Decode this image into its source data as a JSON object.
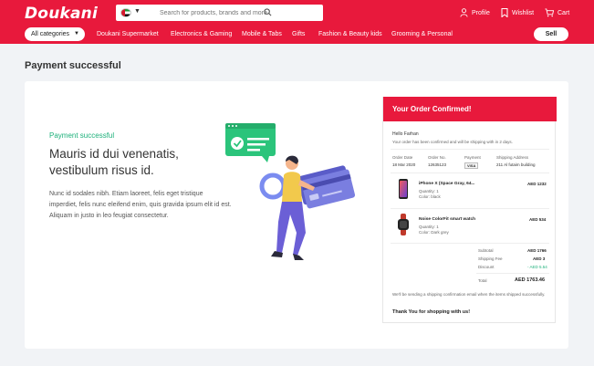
{
  "header": {
    "logo": "Doukani",
    "search_placeholder": "Search for products, brands and more",
    "profile": "Profile",
    "wishlist": "Wishlist",
    "cart": "Cart"
  },
  "catbar": {
    "all_categories": "All categories",
    "links": [
      "Doukani Supermarket",
      "Electronics & Gaming",
      "Mobile & Tabs",
      "Gifts",
      "Fashion & Beauty kids",
      "Grooming & Personal"
    ],
    "sell": "Sell"
  },
  "page": {
    "title": "Payment successful"
  },
  "success": {
    "label": "Payment successful",
    "heading": "Mauris id dui venenatis, vestibulum risus id.",
    "body": "Nunc id sodales nibh. Etiam laoreet, felis eget tristique imperdiet, felis nunc eleifend enim, quis gravida ipsum elit id est. Aliquam in justo in leo feugiat consectetur."
  },
  "order": {
    "title": "Your Order Confirmed!",
    "greeting": "Hello Farhan",
    "note": "Your order has been confirmed and will be shipping with in 2 days.",
    "col_date": "Order Date",
    "col_no": "Order No.",
    "col_payment": "Payment",
    "col_address": "Shipping Address",
    "date": "18 Mar 2020",
    "number": "12635123",
    "payment": "VISA",
    "address": "211 Al futaim building",
    "items": [
      {
        "name": "iPhone X (Space Gray, 64...",
        "qty": "Quantity: 1",
        "color": "Color: black",
        "price": "AED 1232"
      },
      {
        "name": "Noise ColorFit smart watch",
        "qty": "Quantity: 1",
        "color": "Color: Dark grey",
        "price": "AED 534"
      }
    ],
    "subtotal_label": "Subtotal",
    "subtotal": "AED 1766",
    "shipping_label": "Shipping Fee",
    "shipping": "AED 3",
    "discount_label": "Discount",
    "discount": "- AED 5.54",
    "total_label": "Total",
    "total": "AED 1763.46",
    "footer_note": "We'll be sending a shipping confirmation email when the items shipped successfully.",
    "thanks": "Thank You for shopping with us!"
  },
  "colors": {
    "brand": "#e8193c",
    "success": "#1cb07a",
    "illustration_accent": "#2bc47b",
    "illustration_card": "#6f72d8"
  }
}
